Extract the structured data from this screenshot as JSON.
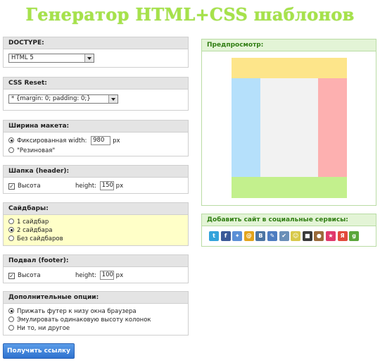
{
  "page_title": "Генератор HTML+CSS шаблонов",
  "doctype": {
    "heading": "DOCTYPE:",
    "selected": "HTML 5"
  },
  "css_reset": {
    "heading": "CSS Reset:",
    "selected": "* {margin: 0; padding: 0;}"
  },
  "layout_width": {
    "heading": "Ширина макета:",
    "fixed_label": "Фиксированная width:",
    "fixed_value": "980",
    "unit": "px",
    "fluid_label": "\"Резиновая\"",
    "selected": "fixed"
  },
  "header": {
    "heading": "Шапка (header):",
    "height_checkbox_label": "Высота",
    "checked": true,
    "height_label": "height:",
    "height_value": "150",
    "unit": "px"
  },
  "sidebars": {
    "heading": "Сайдбары:",
    "options": [
      "1 сайдбар",
      "2 сайдбара",
      "Без сайдбаров"
    ],
    "selected_index": 1
  },
  "footer": {
    "heading": "Подвал (footer):",
    "height_checkbox_label": "Высота",
    "checked": true,
    "height_label": "height:",
    "height_value": "100",
    "unit": "px"
  },
  "extra_options": {
    "heading": "Дополнительные опции:",
    "options": [
      "Прижать футер к низу окна браузера",
      "Эмулировать одинаковую высоту колонок",
      "Ни то, ни другое"
    ],
    "selected_index": 0
  },
  "get_link_button": "Получить ссылку",
  "preview": {
    "heading": "Предпросмотр:",
    "colors": {
      "header": "#fde58a",
      "left_sidebar": "#b5e0fb",
      "content": "#f2f2f2",
      "right_sidebar": "#fdb0b0",
      "footer": "#c3f08d"
    }
  },
  "social": {
    "heading": "Добавить сайт в социальные сервисы:",
    "icons": [
      {
        "name": "twitter-icon",
        "glyph": "t",
        "color": "#33a3db"
      },
      {
        "name": "facebook-icon",
        "glyph": "f",
        "color": "#3b5998"
      },
      {
        "name": "delicious-icon",
        "glyph": "✦",
        "color": "#5b8fd6"
      },
      {
        "name": "mail-ru-icon",
        "glyph": "@",
        "color": "#e3a41b"
      },
      {
        "name": "vkontakte-icon",
        "glyph": "В",
        "color": "#4c75a3"
      },
      {
        "name": "livejournal-icon",
        "glyph": "✎",
        "color": "#4d7cc0"
      },
      {
        "name": "memori-icon",
        "glyph": "✔",
        "color": "#6b8fb8"
      },
      {
        "name": "bobrdobr-icon",
        "glyph": "☺",
        "color": "#d8c94a"
      },
      {
        "name": "delicious-squares-icon",
        "glyph": "■",
        "color": "#3a3a3a"
      },
      {
        "name": "moemesto-icon",
        "glyph": "●",
        "color": "#9a6a3a"
      },
      {
        "name": "favorites-star-icon",
        "glyph": "★",
        "color": "#e0386c"
      },
      {
        "name": "yandex-icon",
        "glyph": "Я",
        "color": "#e24a3c"
      },
      {
        "name": "google-icon",
        "glyph": "g",
        "color": "#5aa63a"
      }
    ]
  }
}
